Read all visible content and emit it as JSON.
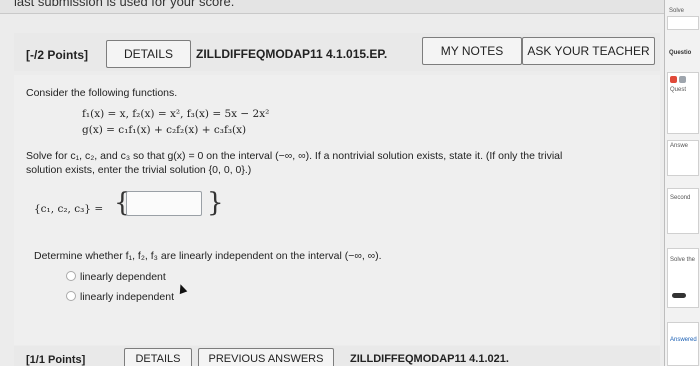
{
  "topbar": {
    "text": "last submission is used for your score."
  },
  "question": {
    "points": "[-/2 Points]",
    "details_label": "DETAILS",
    "id": "ZILLDIFFEQMODAP11 4.1.015.EP.",
    "notes_label": "MY NOTES",
    "ask_label": "ASK YOUR TEACHER",
    "intro": "Consider the following functions.",
    "functions_line1": "f₁(x) = x,   f₂(x) = x²,   f₃(x) = 5x − 2x²",
    "functions_line2": "g(x) = c₁f₁(x) + c₂f₂(x) + c₃f₃(x)",
    "solve_line1": "Solve for c₁, c₂, and c₃ so that g(x) = 0 on the interval (−∞, ∞). If a nontrivial solution exists, state it. (If only the trivial",
    "solve_line2": "solution exists, enter the trivial solution {0, 0, 0}.)",
    "set_label": "{c₁, c₂, c₃} =",
    "brace_open": "{",
    "brace_close": "}",
    "answer_value": "",
    "determine_text": "Determine whether f₁, f₂, f₃ are linearly independent on the interval (−∞, ∞).",
    "options": [
      "linearly dependent",
      "linearly independent"
    ]
  },
  "next_question": {
    "points": "[1/1 Points]",
    "details_label": "DETAILS",
    "previous_label": "PREVIOUS ANSWERS",
    "id": "ZILLDIFFEQMODAP11 4.1.021."
  },
  "sidebar": {
    "solve": "Solve",
    "question_label": "Questio",
    "quest": "Quest",
    "answer": "Answe",
    "second": "Second",
    "solve_the": "Solve the",
    "answered": "Answered"
  }
}
